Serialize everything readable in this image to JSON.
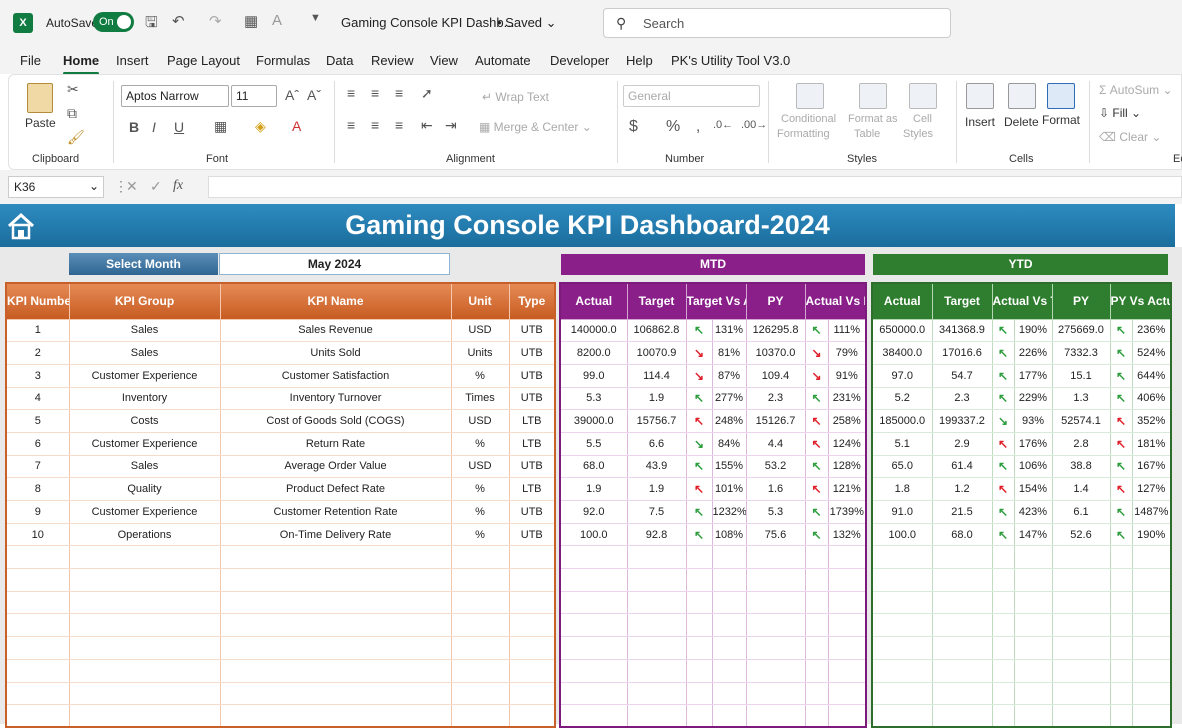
{
  "app": {
    "logo": "X",
    "autosave_label": "AutoSave",
    "toggle_label": "On",
    "doc_title": "Gaming Console KPI Dashb...",
    "saved_label": "• Saved",
    "search_placeholder": "Search"
  },
  "menu": [
    "File",
    "Home",
    "Insert",
    "Page Layout",
    "Formulas",
    "Data",
    "Review",
    "View",
    "Automate",
    "Developer",
    "Help",
    "PK's Utility Tool V3.0"
  ],
  "ribbon": {
    "paste": "Paste",
    "clipboard": "Clipboard",
    "font_name": "Aptos Narrow",
    "font_size": "11",
    "font": "Font",
    "wrap_text": "Wrap Text",
    "merge_center": "Merge & Center",
    "alignment": "Alignment",
    "number_format": "General",
    "number": "Number",
    "conditional": "Conditional",
    "formatting": "Formatting",
    "format_as": "Format as",
    "table": "Table",
    "cell": "Cell",
    "styles_btn": "Styles",
    "styles": "Styles",
    "insert": "Insert",
    "delete": "Delete",
    "format": "Format",
    "cells": "Cells",
    "autosum": "AutoSum",
    "fill": "Fill",
    "clear": "Clear",
    "editing": "Ec"
  },
  "formula_bar": {
    "name_box": "K36",
    "fx": "fx",
    "value": ""
  },
  "dashboard": {
    "title": "Gaming Console KPI Dashboard-2024",
    "select_month_label": "Select Month",
    "select_month_value": "May 2024",
    "mtd_label": "MTD",
    "ytd_label": "YTD",
    "left_headers": [
      "KPI Number",
      "KPI Group",
      "KPI Name",
      "Unit",
      "Type"
    ],
    "mtd_headers": [
      "Actual",
      "Target",
      "Target Vs Actual",
      "PY",
      "Actual Vs PY"
    ],
    "ytd_headers": [
      "Actual",
      "Target",
      "Actual Vs Target",
      "PY",
      "PY Vs Actual"
    ],
    "rows": [
      {
        "num": "1",
        "group": "Sales",
        "name": "Sales Revenue",
        "unit": "USD",
        "type": "UTB",
        "m_actual": "140000.0",
        "m_target": "106862.8",
        "m_tva_dir": "up",
        "m_tva": "131%",
        "m_py": "126295.8",
        "m_avp_dir": "up",
        "m_avp": "111%",
        "y_actual": "650000.0",
        "y_target": "341368.9",
        "y_avt_dir": "up",
        "y_avt": "190%",
        "y_py": "275669.0",
        "y_pva_dir": "up",
        "y_pva": "236%"
      },
      {
        "num": "2",
        "group": "Sales",
        "name": "Units Sold",
        "unit": "Units",
        "type": "UTB",
        "m_actual": "8200.0",
        "m_target": "10070.9",
        "m_tva_dir": "dn",
        "m_tva": "81%",
        "m_py": "10370.0",
        "m_avp_dir": "dn",
        "m_avp": "79%",
        "y_actual": "38400.0",
        "y_target": "17016.6",
        "y_avt_dir": "up",
        "y_avt": "226%",
        "y_py": "7332.3",
        "y_pva_dir": "up",
        "y_pva": "524%"
      },
      {
        "num": "3",
        "group": "Customer Experience",
        "name": "Customer Satisfaction",
        "unit": "%",
        "type": "UTB",
        "m_actual": "99.0",
        "m_target": "114.4",
        "m_tva_dir": "dn",
        "m_tva": "87%",
        "m_py": "109.4",
        "m_avp_dir": "dn",
        "m_avp": "91%",
        "y_actual": "97.0",
        "y_target": "54.7",
        "y_avt_dir": "up",
        "y_avt": "177%",
        "y_py": "15.1",
        "y_pva_dir": "up",
        "y_pva": "644%"
      },
      {
        "num": "4",
        "group": "Inventory",
        "name": "Inventory Turnover",
        "unit": "Times",
        "type": "UTB",
        "m_actual": "5.3",
        "m_target": "1.9",
        "m_tva_dir": "up",
        "m_tva": "277%",
        "m_py": "2.3",
        "m_avp_dir": "up",
        "m_avp": "231%",
        "y_actual": "5.2",
        "y_target": "2.3",
        "y_avt_dir": "up",
        "y_avt": "229%",
        "y_py": "1.3",
        "y_pva_dir": "up",
        "y_pva": "406%"
      },
      {
        "num": "5",
        "group": "Costs",
        "name": "Cost of Goods Sold (COGS)",
        "unit": "USD",
        "type": "LTB",
        "m_actual": "39000.0",
        "m_target": "15756.7",
        "m_tva_dir": "bad",
        "m_tva": "248%",
        "m_py": "15126.7",
        "m_avp_dir": "bad",
        "m_avp": "258%",
        "y_actual": "185000.0",
        "y_target": "199337.2",
        "y_avt_dir": "good",
        "y_avt": "93%",
        "y_py": "52574.1",
        "y_pva_dir": "bad",
        "y_pva": "352%"
      },
      {
        "num": "6",
        "group": "Customer Experience",
        "name": "Return Rate",
        "unit": "%",
        "type": "LTB",
        "m_actual": "5.5",
        "m_target": "6.6",
        "m_tva_dir": "good",
        "m_tva": "84%",
        "m_py": "4.4",
        "m_avp_dir": "bad",
        "m_avp": "124%",
        "y_actual": "5.1",
        "y_target": "2.9",
        "y_avt_dir": "bad",
        "y_avt": "176%",
        "y_py": "2.8",
        "y_pva_dir": "bad",
        "y_pva": "181%"
      },
      {
        "num": "7",
        "group": "Sales",
        "name": "Average Order Value",
        "unit": "USD",
        "type": "UTB",
        "m_actual": "68.0",
        "m_target": "43.9",
        "m_tva_dir": "up",
        "m_tva": "155%",
        "m_py": "53.2",
        "m_avp_dir": "up",
        "m_avp": "128%",
        "y_actual": "65.0",
        "y_target": "61.4",
        "y_avt_dir": "up",
        "y_avt": "106%",
        "y_py": "38.8",
        "y_pva_dir": "up",
        "y_pva": "167%"
      },
      {
        "num": "8",
        "group": "Quality",
        "name": "Product Defect Rate",
        "unit": "%",
        "type": "LTB",
        "m_actual": "1.9",
        "m_target": "1.9",
        "m_tva_dir": "bad",
        "m_tva": "101%",
        "m_py": "1.6",
        "m_avp_dir": "bad",
        "m_avp": "121%",
        "y_actual": "1.8",
        "y_target": "1.2",
        "y_avt_dir": "bad",
        "y_avt": "154%",
        "y_py": "1.4",
        "y_pva_dir": "bad",
        "y_pva": "127%"
      },
      {
        "num": "9",
        "group": "Customer Experience",
        "name": "Customer Retention Rate",
        "unit": "%",
        "type": "UTB",
        "m_actual": "92.0",
        "m_target": "7.5",
        "m_tva_dir": "up",
        "m_tva": "1232%",
        "m_py": "5.3",
        "m_avp_dir": "up",
        "m_avp": "1739%",
        "y_actual": "91.0",
        "y_target": "21.5",
        "y_avt_dir": "up",
        "y_avt": "423%",
        "y_py": "6.1",
        "y_pva_dir": "up",
        "y_pva": "1487%"
      },
      {
        "num": "10",
        "group": "Operations",
        "name": "On-Time Delivery Rate",
        "unit": "%",
        "type": "UTB",
        "m_actual": "100.0",
        "m_target": "92.8",
        "m_tva_dir": "up",
        "m_tva": "108%",
        "m_py": "75.6",
        "m_avp_dir": "up",
        "m_avp": "132%",
        "y_actual": "100.0",
        "y_target": "68.0",
        "y_avt_dir": "up",
        "y_avt": "147%",
        "y_py": "52.6",
        "y_pva_dir": "up",
        "y_pva": "190%"
      }
    ]
  },
  "colors": {
    "excel_green": "#107c41",
    "banner": "#2a86bb",
    "orange": "#d2692e",
    "purple": "#8a1f8a",
    "green": "#2f7d2f",
    "arrow_up": "#2e9e3e",
    "arrow_down": "#e0202a"
  }
}
